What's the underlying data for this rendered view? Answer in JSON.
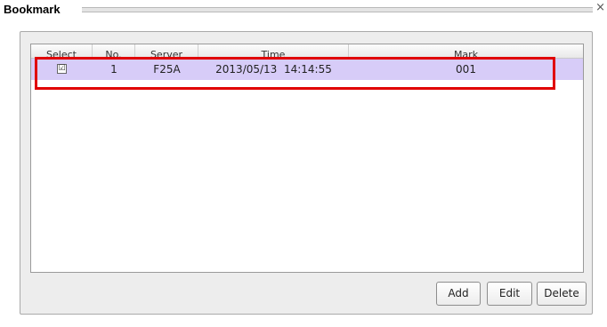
{
  "window": {
    "title": "Bookmark",
    "close_glyph": "×"
  },
  "table": {
    "columns": [
      "Select",
      "No.",
      "Server",
      "Time",
      "Mark"
    ],
    "rows": [
      {
        "selected": true,
        "check_glyph": "☑",
        "no": "1",
        "server": "F25A",
        "time": "2013/05/13  14:14:55",
        "mark": "001"
      }
    ]
  },
  "buttons": {
    "add": "Add",
    "edit": "Edit",
    "delete": "Delete"
  },
  "colors": {
    "selected_row": "#d7ccf8",
    "highlight": "#e00000"
  }
}
